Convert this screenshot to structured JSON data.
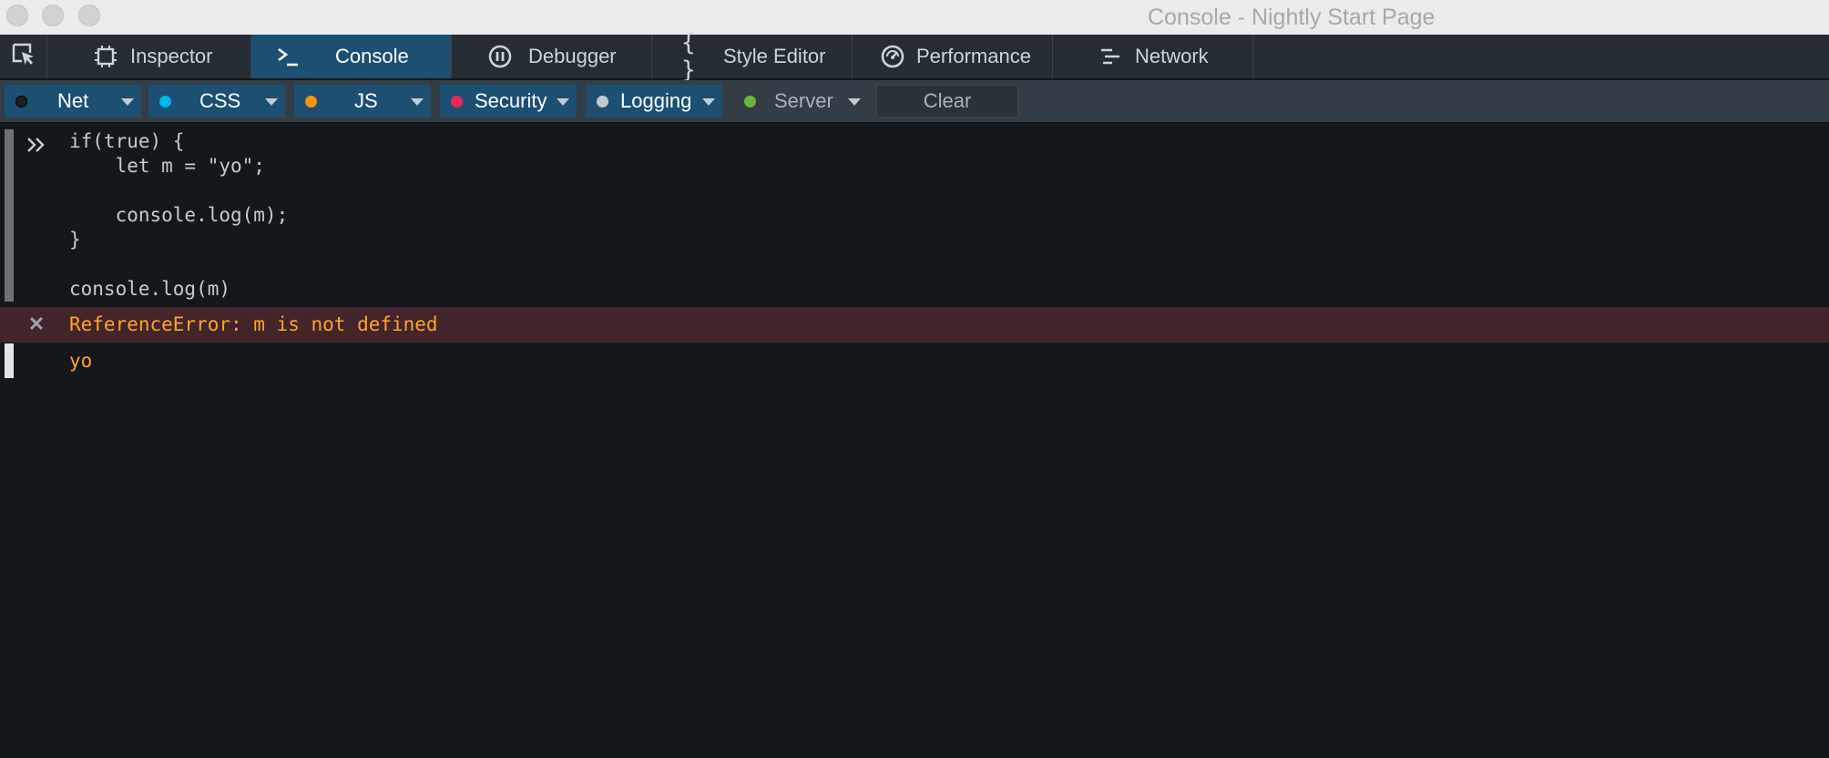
{
  "window": {
    "title": "Console - Nightly Start Page"
  },
  "toolbar": {
    "tabs": [
      {
        "label": "Inspector",
        "icon": "inspector-icon",
        "selected": false
      },
      {
        "label": "Console",
        "icon": "console-icon",
        "selected": true
      },
      {
        "label": "Debugger",
        "icon": "debugger-icon",
        "selected": false
      },
      {
        "label": "Style Editor",
        "icon": "braces-icon",
        "selected": false
      },
      {
        "label": "Performance",
        "icon": "performance-icon",
        "selected": false
      },
      {
        "label": "Network",
        "icon": "network-icon",
        "selected": false
      }
    ]
  },
  "filters": {
    "items": [
      {
        "label": "Net",
        "dot_color": "#202020",
        "enabled": true
      },
      {
        "label": "CSS",
        "dot_color": "#00b6f0",
        "enabled": true
      },
      {
        "label": "JS",
        "dot_color": "#fb9500",
        "enabled": true
      },
      {
        "label": "Security",
        "dot_color": "#ed2655",
        "enabled": true
      },
      {
        "label": "Logging",
        "dot_color": "#c4c9cf",
        "enabled": true
      },
      {
        "label": "Server",
        "dot_color": "#6cb33e",
        "enabled": false
      }
    ],
    "clear_label": "Clear"
  },
  "console": {
    "input_code": "if(true) {\n    let m = \"yo\";\n\n    console.log(m);\n}\n\nconsole.log(m)",
    "error_text": "ReferenceError: m is not defined",
    "log_text": "yo"
  },
  "colors": {
    "selected_tab": "#1d4f73",
    "error_background": "#42242a",
    "error_text": "#ffa42a",
    "console_background": "#14181c"
  }
}
